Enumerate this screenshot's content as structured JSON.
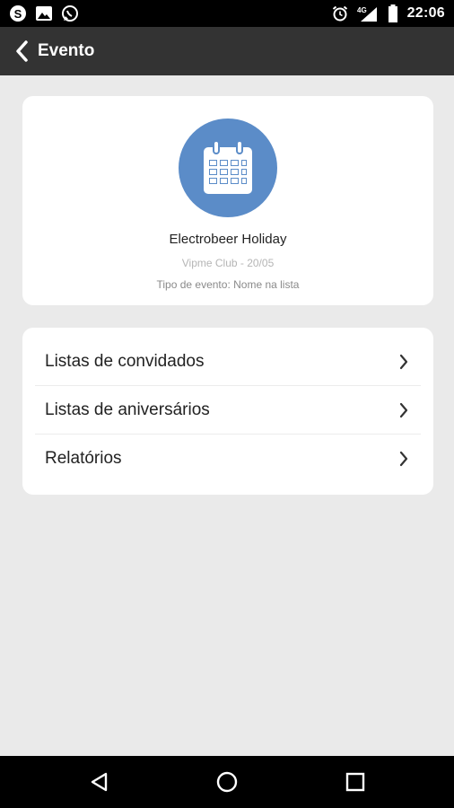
{
  "status_bar": {
    "time": "22:06",
    "network": "4G",
    "icons": [
      "skype-icon",
      "image-icon",
      "whatsapp-icon",
      "alarm-icon",
      "signal-icon",
      "battery-icon"
    ]
  },
  "toolbar": {
    "title": "Evento",
    "back_icon": "chevron-left-icon"
  },
  "event": {
    "icon": "calendar-icon",
    "icon_bg": "#5b8cc8",
    "title": "Electrobeer Holiday",
    "subtitle": "Vipme Club - 20/05",
    "type": "Tipo de evento: Nome na lista"
  },
  "menu": {
    "items": [
      {
        "label": "Listas de convidados"
      },
      {
        "label": "Listas de aniversários"
      },
      {
        "label": "Relatórios"
      }
    ]
  },
  "nav": {
    "icons": [
      "back-triangle-icon",
      "home-circle-icon",
      "recents-square-icon"
    ]
  }
}
